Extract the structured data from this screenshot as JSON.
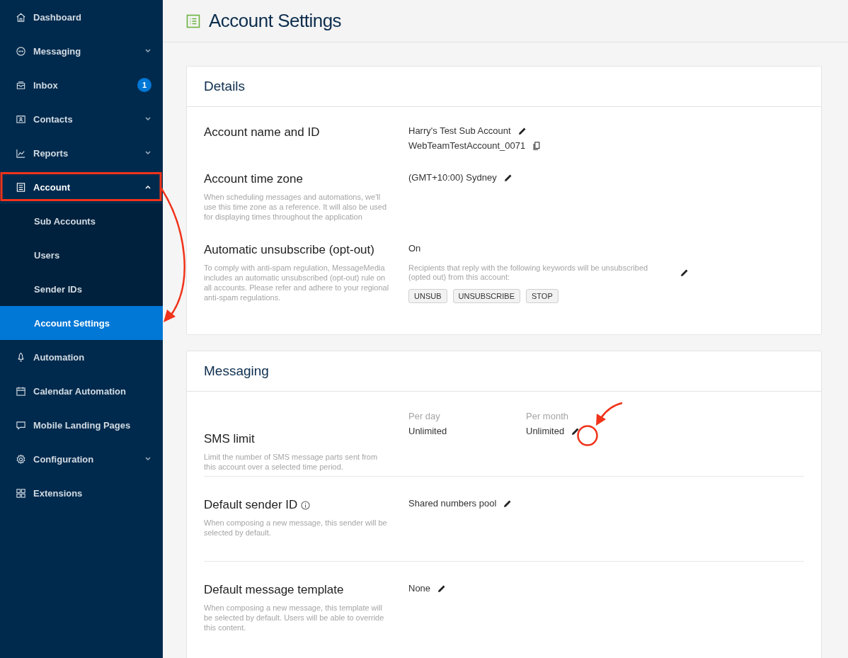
{
  "sidebar": {
    "items": [
      {
        "label": "Dashboard",
        "expandable": false,
        "selected": false
      },
      {
        "label": "Messaging",
        "expandable": true,
        "expanded": false,
        "selected": false
      },
      {
        "label": "Inbox",
        "expandable": false,
        "selected": false,
        "badge": "1"
      },
      {
        "label": "Contacts",
        "expandable": true,
        "expanded": false,
        "selected": false
      },
      {
        "label": "Reports",
        "expandable": true,
        "expanded": false,
        "selected": false
      },
      {
        "label": "Account",
        "expandable": true,
        "expanded": true,
        "selected": true,
        "children": [
          {
            "label": "Sub Accounts",
            "selected": false
          },
          {
            "label": "Users",
            "selected": false
          },
          {
            "label": "Sender IDs",
            "selected": false
          },
          {
            "label": "Account Settings",
            "selected": true
          }
        ]
      },
      {
        "label": "Automation",
        "expandable": false,
        "selected": false
      },
      {
        "label": "Calendar Automation",
        "expandable": false,
        "selected": false
      },
      {
        "label": "Mobile Landing Pages",
        "expandable": false,
        "selected": false
      },
      {
        "label": "Configuration",
        "expandable": true,
        "expanded": false,
        "selected": false
      },
      {
        "label": "Extensions",
        "expandable": false,
        "selected": false
      }
    ]
  },
  "page": {
    "title": "Account Settings"
  },
  "sections": [
    {
      "title": "Details",
      "dividers": false,
      "rows": [
        {
          "kind": "name_id",
          "title": "Account name and ID",
          "name": "Harry's Test Sub Account",
          "id": "WebTeamTestAccount_0071"
        },
        {
          "kind": "value",
          "title": "Account time zone",
          "description": "When scheduling messages and automations, we'll use this time zone as a reference. It will also be used for displaying times throughout the application",
          "value": "(GMT+10:00) Sydney"
        },
        {
          "kind": "optout",
          "title": "Automatic unsubscribe (opt-out)",
          "description": "To comply with anti-spam regulation, MessageMedia includes an automatic unsubscribed (opt-out) rule on all accounts. Please refer and adhere to your regional anti-spam regulations.",
          "status": "On",
          "note": "Recipients that reply with the following keywords will be unsubscribed (opted out) from this account:",
          "keywords": [
            "UNSUB",
            "UNSUBSCRIBE",
            "STOP"
          ]
        }
      ]
    },
    {
      "title": "Messaging",
      "dividers": true,
      "rows": [
        {
          "kind": "limit",
          "title": "SMS limit",
          "description": "Limit the number of SMS message parts sent from this account over a selected time period.",
          "limits": [
            {
              "label": "Per day",
              "value": "Unlimited"
            },
            {
              "label": "Per month",
              "value": "Unlimited"
            }
          ]
        },
        {
          "kind": "value",
          "title": "Default sender ID",
          "info": true,
          "description": "When composing a new message, this sender will be selected by default.",
          "value": "Shared numbers pool"
        },
        {
          "kind": "value",
          "title": "Default message template",
          "description": "When composing a new message, this template will be selected by default. Users will be able to override this content.",
          "value": "None"
        }
      ]
    }
  ]
}
